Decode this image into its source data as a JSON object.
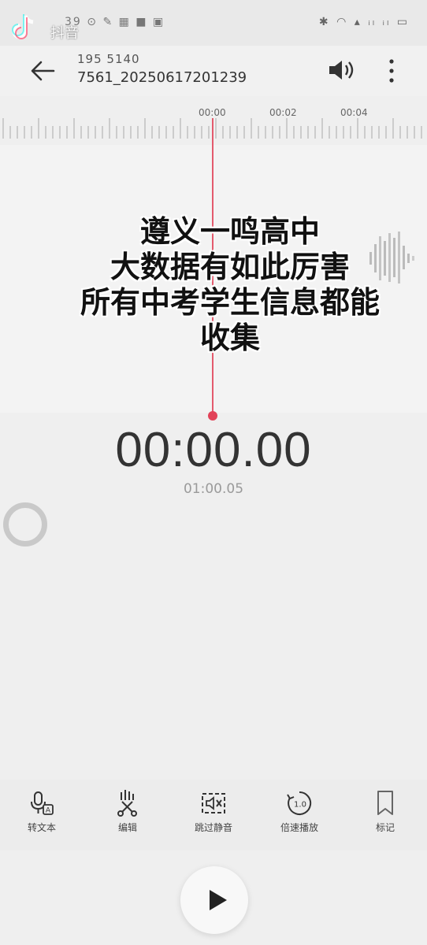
{
  "status_bar": {
    "tiktok_label": "抖音",
    "left_icons": "39 ⊙ ✎ ▦ ■ ▣",
    "right_icons": "✱ ◠ ▴ ᵢₗ ᵢₗ ▭"
  },
  "header": {
    "title_line1": "195 5140",
    "title_line2": "7561_20250617201239"
  },
  "timeline": {
    "ticks": [
      "00:00",
      "00:02",
      "00:04"
    ]
  },
  "overlay": {
    "lines": [
      "遵义一鸣高中",
      "大数据有如此厉害",
      "所有中考学生信息都能",
      "收集"
    ]
  },
  "player": {
    "timer": "00:00.00",
    "duration": "01:00.05"
  },
  "toolbar": {
    "items": [
      {
        "label": "转文本",
        "icon": "mic-text-icon"
      },
      {
        "label": "编辑",
        "icon": "scissors-wave-icon"
      },
      {
        "label": "跳过静音",
        "icon": "skip-silence-icon"
      },
      {
        "label": "倍速播放",
        "icon": "speed-icon"
      },
      {
        "label": "标记",
        "icon": "bookmark-icon"
      }
    ]
  },
  "colors": {
    "accent": "#e24258",
    "background": "#efefef",
    "text": "#333333"
  }
}
